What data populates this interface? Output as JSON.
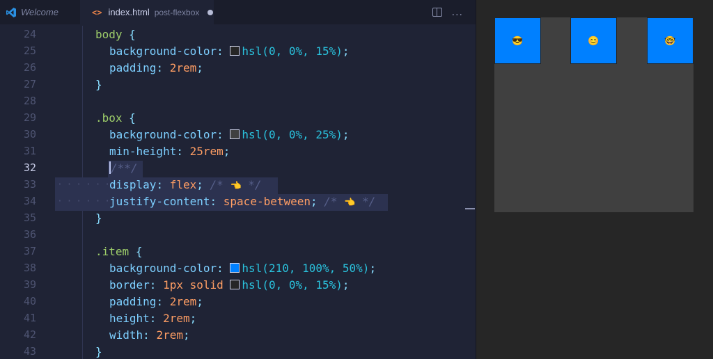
{
  "tabs": {
    "welcome": "Welcome",
    "file": "index.html",
    "description": "post-flexbox",
    "file_icon": "<>"
  },
  "actions": {
    "split": "split-editor-icon",
    "more": "..."
  },
  "code": {
    "line_numbers": [
      "24",
      "25",
      "26",
      "27",
      "28",
      "29",
      "30",
      "31",
      "32",
      "33",
      "34",
      "35",
      "36",
      "37",
      "38",
      "39",
      "40",
      "41",
      "42",
      "43"
    ],
    "current_line": "32",
    "body_selector": "body",
    "open_brace": "{",
    "close_brace": "}",
    "bg_prop": "background-color",
    "colon": ":",
    "semicolon": ";",
    "hsl_body": "hsl(0, 0%, 15%)",
    "padding_prop": "padding",
    "padding_val": "2rem",
    "box_selector": ".box",
    "hsl_box": "hsl(0, 0%, 25%)",
    "minheight_prop": "min-height",
    "minheight_val": "25rem",
    "empty_comment": "/**/",
    "display_prop": "display",
    "display_val": "flex",
    "comment_open": "/*",
    "comment_close": "*/",
    "hand_emoji": "👈",
    "justify_prop": "justify-content",
    "justify_val": "space-between",
    "item_selector": ".item",
    "hsl_item": "hsl(210, 100%, 50%)",
    "border_prop": "border",
    "border_val": "1px solid",
    "hsl_border": "hsl(0, 0%, 15%)",
    "height_prop": "height",
    "height_val": "2rem",
    "width_prop": "width",
    "width_val": "2rem"
  },
  "colors": {
    "swatch_body": "#262626",
    "swatch_box": "#404040",
    "swatch_item": "#0080ff"
  },
  "preview": {
    "items": [
      "😎",
      "😊",
      "🤓"
    ]
  }
}
